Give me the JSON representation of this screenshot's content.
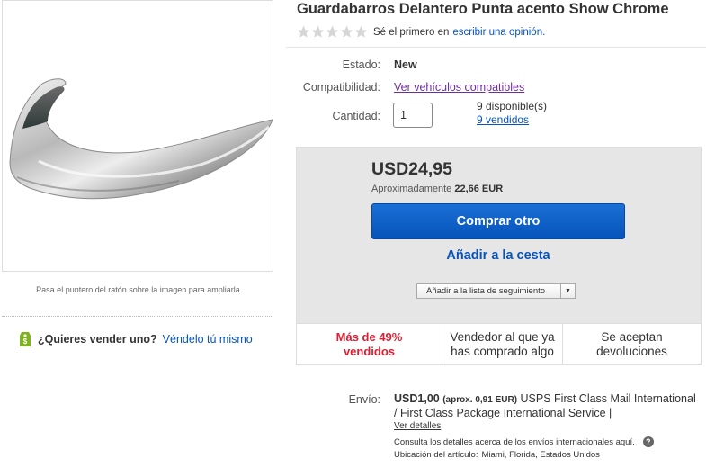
{
  "product": {
    "title": "Guardabarros Delantero Punta acento Show Chrome",
    "image_icon": "chrome-fender-tip",
    "zoom_hint": "Pasa el puntero del ratón sobre la imagen para ampliarla"
  },
  "rating": {
    "stars": 0,
    "max_stars": 5,
    "text": "Sé el primero en",
    "link": "escribir una opinión."
  },
  "attributes": {
    "condition_label": "Estado:",
    "condition_value": "New",
    "compat_label": "Compatibilidad:",
    "compat_link": "Ver vehículos compatibles",
    "qty_label": "Cantidad:",
    "qty_value": "1",
    "available": "9 disponible(s)",
    "sold": "9 vendidos"
  },
  "buy": {
    "price": "USD24,95",
    "approx_label": "Aproximadamente",
    "approx_value": "22,66 EUR",
    "buy_button": "Comprar otro",
    "cart_link": "Añadir a la cesta",
    "watch_button": "Añadir a la lista de seguimiento"
  },
  "info": {
    "sold_pct": "Más de 49% vendidos",
    "seller": "Vendedor al que ya has comprado algo",
    "returns": "Se aceptan devoluciones"
  },
  "sell": {
    "question": "¿Quieres vender uno?",
    "link": "Véndelo tú mismo"
  },
  "shipping": {
    "label": "Envío:",
    "amount": "USD1,00",
    "approx": "(aprox. 0,91 EUR)",
    "service": "USPS First Class Mail International / First Class Package International Service |",
    "details": "Ver detalles",
    "intl_note": "Consulta los detalles acerca de los envíos internacionales aquí.",
    "location_label": "Ubicación del artículo:",
    "location": "Miami, Florida, Estados Unidos"
  },
  "colors": {
    "link": "#0654ba",
    "buy_button": "#0654ba",
    "sold_red": "#dd1e31",
    "buybox_bg": "#e6e6e6"
  }
}
